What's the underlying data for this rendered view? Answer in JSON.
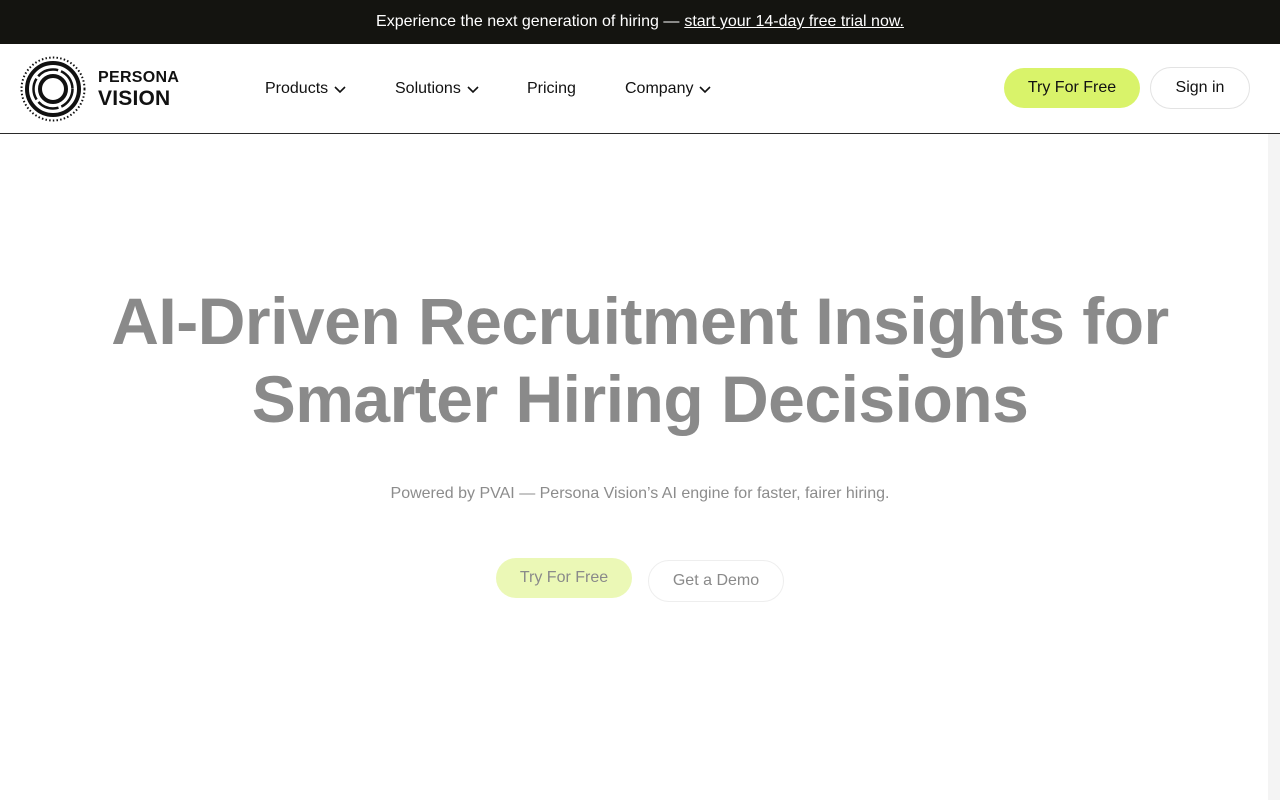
{
  "announcement": {
    "text": "Experience the next generation of hiring —",
    "link": "start your 14-day free trial now."
  },
  "logo": {
    "line1": "PERSONA",
    "line2": "VISION",
    "icon": "concentric-circles-logo-icon"
  },
  "nav": {
    "items": [
      {
        "label": "Products",
        "has_dropdown": true
      },
      {
        "label": "Solutions",
        "has_dropdown": true
      },
      {
        "label": "Pricing",
        "has_dropdown": false
      },
      {
        "label": "Company",
        "has_dropdown": true
      }
    ],
    "try_label": "Try For Free",
    "signin_label": "Sign in"
  },
  "hero": {
    "title_line1": "AI-Driven Recruitment Insights for",
    "title_line2": "Smarter Hiring Decisions",
    "subtitle": "Powered by PVAI — Persona Vision’s AI engine for faster, fairer hiring.",
    "try_label": "Try For Free",
    "demo_label": "Get a Demo"
  },
  "colors": {
    "accent": "#d9f36a",
    "announcement_bg": "#141410",
    "hero_text": "#8a8a8a"
  }
}
